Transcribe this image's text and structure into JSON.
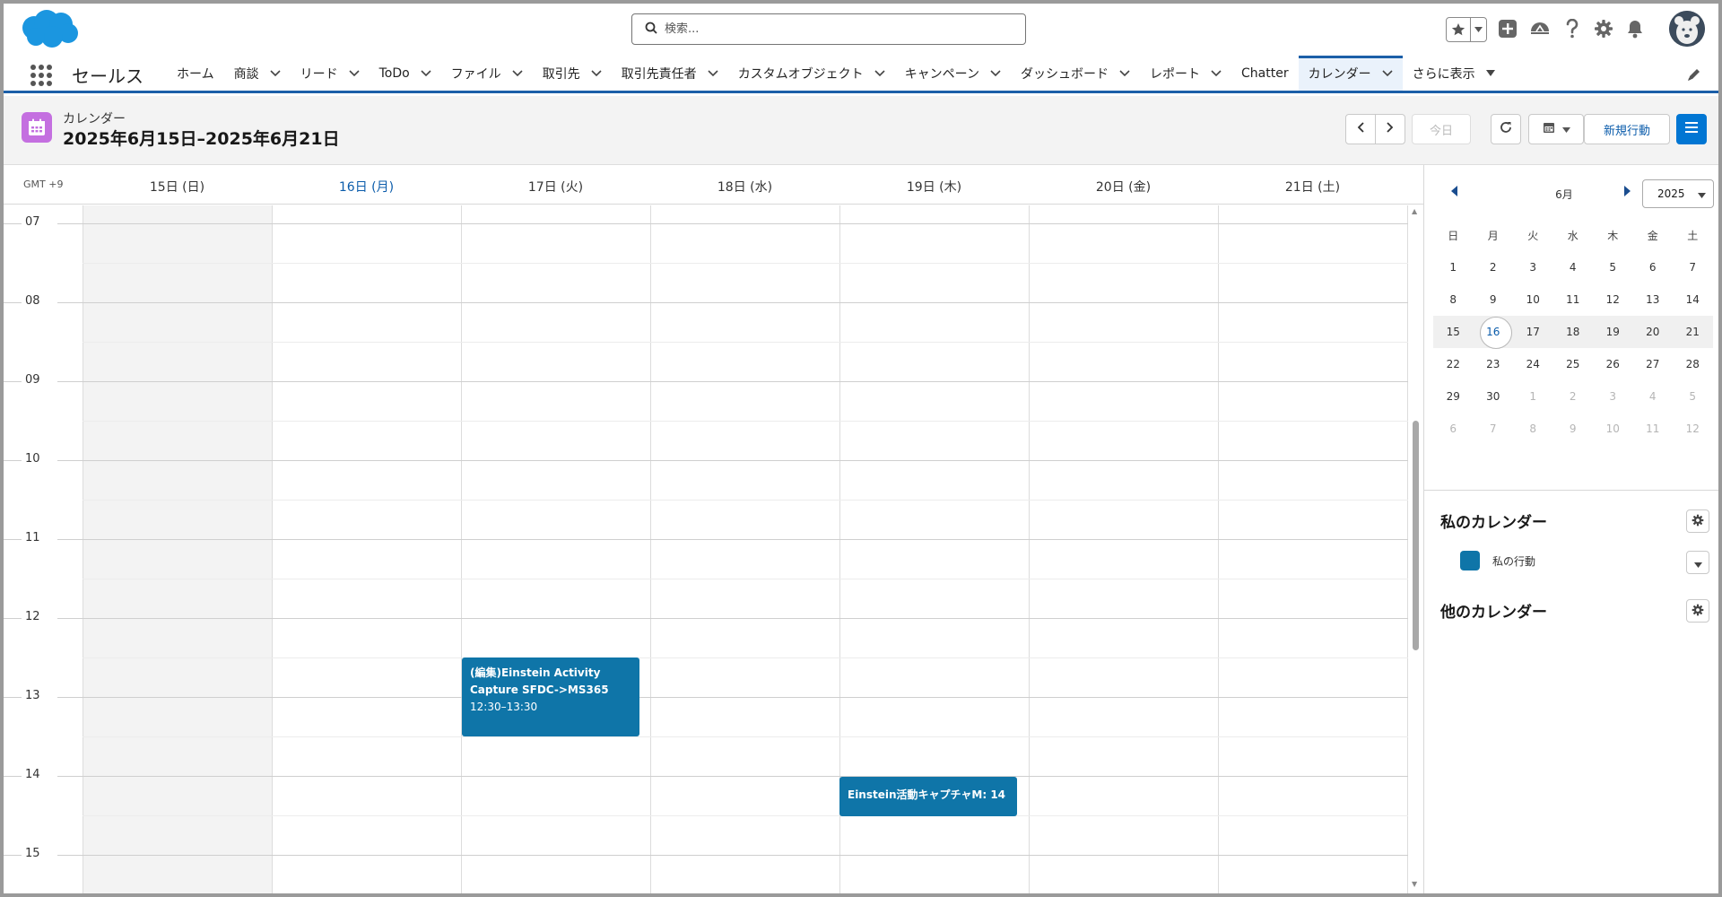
{
  "header": {
    "search_placeholder": "検索..."
  },
  "nav": {
    "app_name": "セールス",
    "tabs": [
      {
        "label": "ホーム",
        "dropdown": false
      },
      {
        "label": "商談",
        "dropdown": true
      },
      {
        "label": "リード",
        "dropdown": true
      },
      {
        "label": "ToDo",
        "dropdown": true
      },
      {
        "label": "ファイル",
        "dropdown": true
      },
      {
        "label": "取引先",
        "dropdown": true
      },
      {
        "label": "取引先責任者",
        "dropdown": true
      },
      {
        "label": "カスタムオブジェクト",
        "dropdown": true
      },
      {
        "label": "キャンペーン",
        "dropdown": true
      },
      {
        "label": "ダッシュボード",
        "dropdown": true
      },
      {
        "label": "レポート",
        "dropdown": true
      },
      {
        "label": "Chatter",
        "dropdown": false
      },
      {
        "label": "カレンダー",
        "dropdown": true,
        "active": true
      },
      {
        "label": "さらに表示",
        "dropdown": true,
        "more": true
      }
    ]
  },
  "page_header": {
    "subtitle": "カレンダー",
    "title": "2025年6月15日–2025年6月21日",
    "today_button": "今日",
    "new_event_button": "新規行動"
  },
  "calendar": {
    "timezone": "GMT +9",
    "days": [
      "15日 (日)",
      "16日 (月)",
      "17日 (火)",
      "18日 (水)",
      "19日 (木)",
      "20日 (金)",
      "21日 (土)"
    ],
    "today_index": 1,
    "hours": [
      "07",
      "08",
      "09",
      "10",
      "11",
      "12",
      "13",
      "14",
      "15"
    ],
    "events": [
      {
        "title": "(編集)Einstein Activity Capture SFDC->MS365",
        "time": "12:30–13:30",
        "day": "17日 (火)"
      },
      {
        "title": "Einstein活動キャプチャM: 14",
        "time": "",
        "day": "19日 (木)"
      }
    ],
    "event_color": "#0f75a8"
  },
  "mini_calendar": {
    "month": "6月",
    "year": "2025",
    "weekdays": [
      "日",
      "月",
      "火",
      "水",
      "木",
      "金",
      "土"
    ],
    "weeks": [
      [
        "1",
        "2",
        "3",
        "4",
        "5",
        "6",
        "7"
      ],
      [
        "8",
        "9",
        "10",
        "11",
        "12",
        "13",
        "14"
      ],
      [
        "15",
        "16",
        "17",
        "18",
        "19",
        "20",
        "21"
      ],
      [
        "22",
        "23",
        "24",
        "25",
        "26",
        "27",
        "28"
      ],
      [
        "29",
        "30",
        "1",
        "2",
        "3",
        "4",
        "5"
      ],
      [
        "6",
        "7",
        "8",
        "9",
        "10",
        "11",
        "12"
      ]
    ],
    "selected_day": "16"
  },
  "sidebar": {
    "my_calendars_title": "私のカレンダー",
    "my_calendar_item": "私の行動",
    "other_calendars_title": "他のカレンダー"
  }
}
